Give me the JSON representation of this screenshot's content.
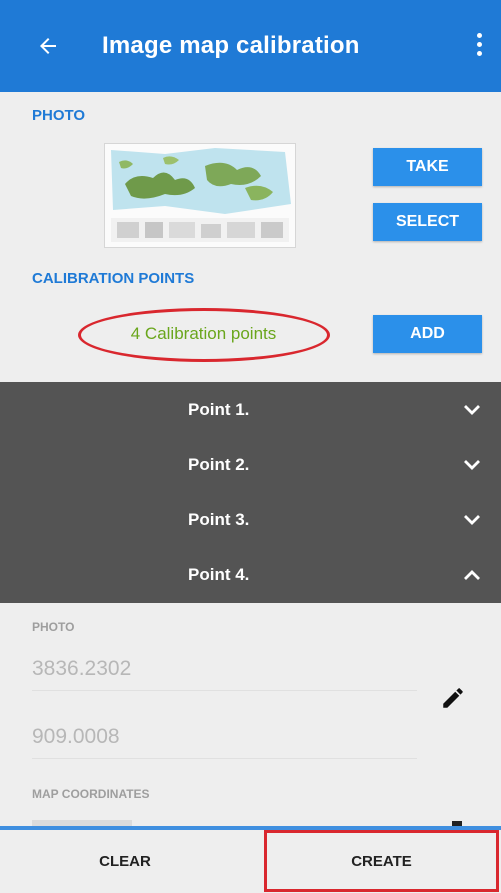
{
  "appbar": {
    "title": "Image map calibration"
  },
  "photo_section": {
    "heading": "PHOTO",
    "take_label": "TAKE",
    "select_label": "SELECT"
  },
  "calibration_section": {
    "heading": "CALIBRATION POINTS",
    "count_text": "4 Calibration points",
    "add_label": "ADD"
  },
  "points": [
    {
      "label": "Point 1.",
      "expanded": false
    },
    {
      "label": "Point 2.",
      "expanded": false
    },
    {
      "label": "Point 3.",
      "expanded": false
    },
    {
      "label": "Point 4.",
      "expanded": true
    }
  ],
  "point_detail": {
    "photo_heading": "PHOTO",
    "photo_x": "3836.2302",
    "photo_y": "909.0008",
    "map_heading": "MAP COORDINATES"
  },
  "bottom_bar": {
    "clear_label": "CLEAR",
    "create_label": "CREATE"
  },
  "colors": {
    "primary": "#1f7ad6",
    "button": "#2b90ea",
    "highlight": "#d9272e",
    "points_bg": "#545454"
  }
}
